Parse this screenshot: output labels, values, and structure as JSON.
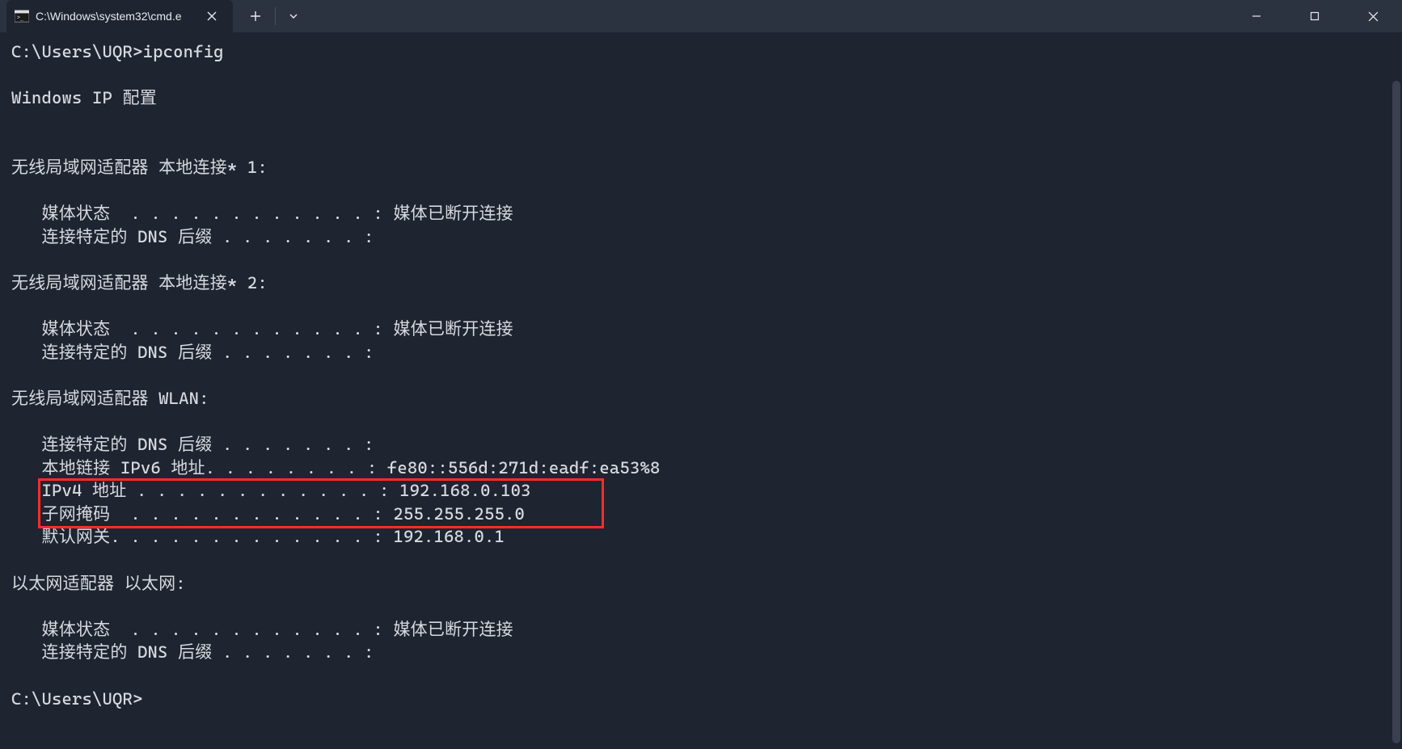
{
  "titlebar": {
    "tab_title": "C:\\Windows\\system32\\cmd.e"
  },
  "terminal": {
    "prompt1": "C:\\Users\\UQR>ipconfig",
    "blank": "",
    "header": "Windows IP 配置",
    "adapter1": {
      "title": "无线局域网适配器 本地连接* 1:",
      "media_line": "   媒体状态  . . . . . . . . . . . . : 媒体已断开连接",
      "dns_line": "   连接特定的 DNS 后缀 . . . . . . . :"
    },
    "adapter2": {
      "title": "无线局域网适配器 本地连接* 2:",
      "media_line": "   媒体状态  . . . . . . . . . . . . : 媒体已断开连接",
      "dns_line": "   连接特定的 DNS 后缀 . . . . . . . :"
    },
    "adapter3": {
      "title": "无线局域网适配器 WLAN:",
      "dns_line": "   连接特定的 DNS 后缀 . . . . . . . :",
      "ipv6_line": "   本地链接 IPv6 地址. . . . . . . . : fe80::556d:271d:eadf:ea53%8",
      "ipv4_line": "   IPv4 地址 . . . . . . . . . . . . : 192.168.0.103",
      "subnet_line": "   子网掩码  . . . . . . . . . . . . : 255.255.255.0",
      "gateway_line": "   默认网关. . . . . . . . . . . . . : 192.168.0.1"
    },
    "adapter4": {
      "title": "以太网适配器 以太网:",
      "media_line": "   媒体状态  . . . . . . . . . . . . : 媒体已断开连接",
      "dns_line": "   连接特定的 DNS 后缀 . . . . . . . :"
    },
    "prompt2": "C:\\Users\\UQR>"
  }
}
